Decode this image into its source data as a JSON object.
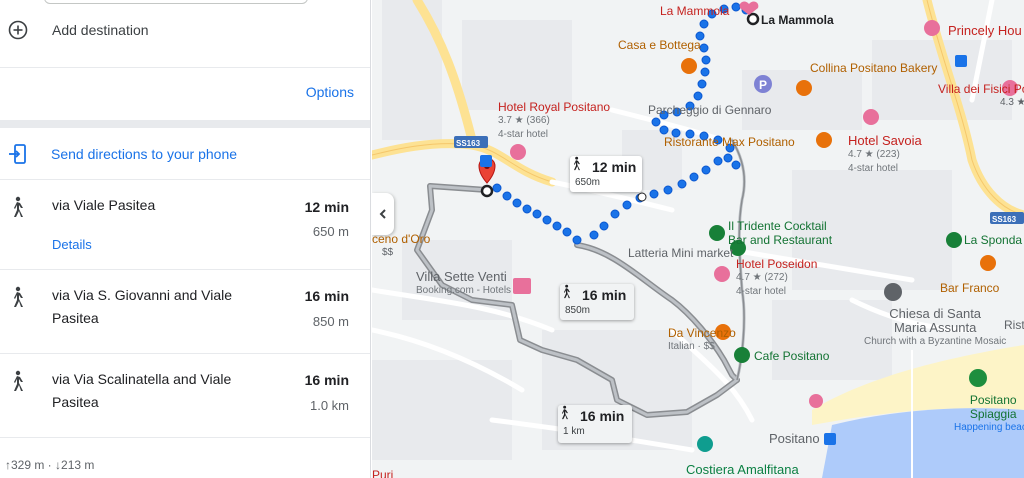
{
  "panel": {
    "add_destination": "Add destination",
    "options": "Options",
    "send_directions": "Send directions to your phone",
    "routes": [
      {
        "name": "via Viale Pasitea",
        "time": "12 min",
        "distance": "650 m",
        "details": "Details"
      },
      {
        "name": "via Via S. Giovanni and Viale Pasitea",
        "time": "16 min",
        "distance": "850 m"
      },
      {
        "name": "via Via Scalinatella and Viale Pasitea",
        "time": "16 min",
        "distance": "1.0 km"
      }
    ],
    "elevation": "↑329 m · ↓213 m"
  },
  "map": {
    "bubbles": [
      {
        "time": "12 min",
        "distance": "650m"
      },
      {
        "time": "16 min",
        "distance": "850m"
      },
      {
        "time": "16 min",
        "distance": "1 km"
      }
    ],
    "destination_label": "La Mammola",
    "pois": {
      "la_mammola_red": "La Mammola",
      "casa_bottega": "Casa e Bottega",
      "princely": "Princely Hou",
      "collina": "Collina Positano Bakery",
      "villa_fisici": "Villa dei Fisici Positano",
      "villa_fisici_rating": "4.3 ★",
      "hotel_royal": "Hotel Royal Positano",
      "hotel_royal_rating": "3.7 ★ (366)",
      "hotel_royal_sub": "4-star hotel",
      "parcheggio": "Parcheggio di Gennaro",
      "ristorante_max": "Ristorante Max Positano",
      "hotel_savoia": "Hotel Savoia",
      "hotel_savoia_rating": "4.7 ★ (223)",
      "hotel_savoia_sub": "4-star hotel",
      "ss163_left": "SS163",
      "ss163_right": "SS163",
      "il_tridente": "Il Tridente Cocktail",
      "il_tridente_2": "Bar and Restaurant",
      "latteria": "Latteria Mini market",
      "hotel_poseidon": "Hotel Poseidon",
      "hotel_poseidon_rating": "4.7 ★ (272)",
      "hotel_poseidon_sub": "4-star hotel",
      "la_sponda": "La Sponda",
      "bar_franco": "Bar Franco",
      "ceno_oro": "ceno d'Oro",
      "ceno_price": "$$",
      "villa_sette": "Villa Sette Venti",
      "villa_sette_sub": "Booking.com - Hotels",
      "chiesa": "Chiesa di Santa",
      "chiesa_2": "Maria Assunta",
      "chiesa_sub": "Church with a Byzantine Mosaic",
      "ristorante_r": "Risto",
      "da_vincenzo": "Da Vincenzo",
      "da_vincenzo_sub": "Italian · $$",
      "cafe_positano": "Cafe Positano",
      "positano": "Positano",
      "positano_spiaggia": "Positano",
      "positano_spiaggia_2": "Spiaggia",
      "positano_spiaggia_sub": "Happening beach",
      "costiera": "Costiera Amalfitana",
      "puri": "Puri"
    },
    "colors": {
      "route_active": "#1a73e8",
      "route_alt": "#9aa0a6",
      "water": "#aecbfa",
      "beach": "#fdf4c7",
      "road_major": "#fde293"
    }
  }
}
